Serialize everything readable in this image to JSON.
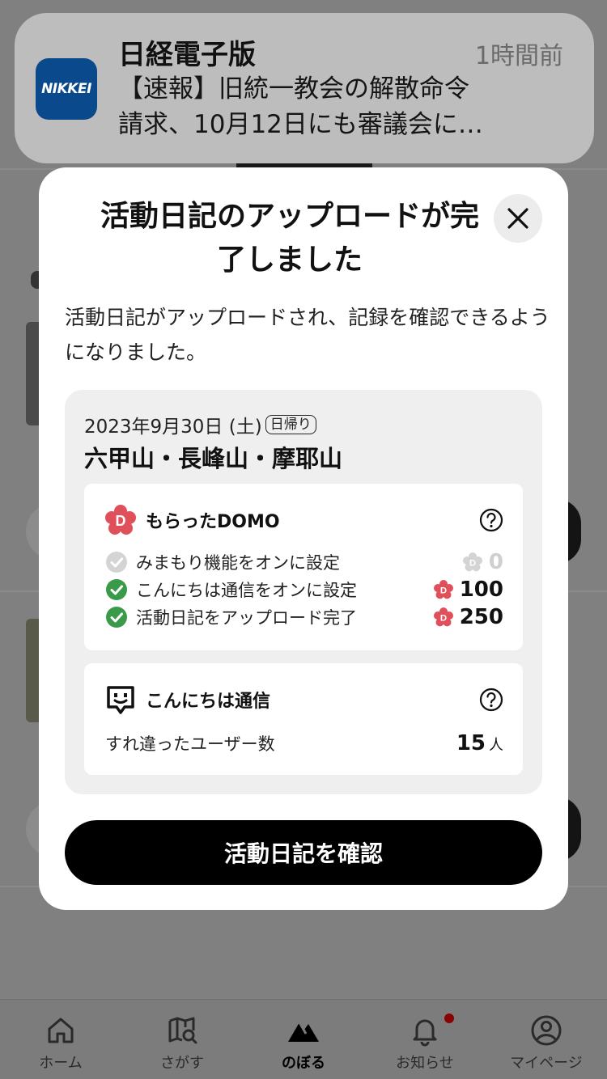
{
  "notification": {
    "app_name": "日経電子版",
    "time": "1時間前",
    "logo_text": "NIKKEI",
    "line1": "【速報】旧統一教会の解散命令",
    "line2": "請求、10月12日にも審議会に…"
  },
  "modal": {
    "title": "活動日記のアップロードが完了しました",
    "description": "活動日記がアップロードされ、記録を確認できるようになりました。",
    "summary": {
      "date": "2023年9月30日 (土)",
      "trip_type": "日帰り",
      "route_name": "六甲山・長峰山・摩耶山"
    },
    "domo": {
      "title": "もらったDOMO",
      "items": [
        {
          "label": "みまもり機能をオンに設定",
          "points": "0",
          "done": false
        },
        {
          "label": "こんにちは通信をオンに設定",
          "points": "100",
          "done": true
        },
        {
          "label": "活動日記をアップロード完了",
          "points": "250",
          "done": true
        }
      ]
    },
    "konnichiwa": {
      "title": "こんにちは通信",
      "label": "すれ違ったユーザー数",
      "count": "15",
      "unit": "人"
    },
    "cta_label": "活動日記を確認"
  },
  "tabbar": {
    "items": [
      {
        "label": "ホーム",
        "icon": "home-icon"
      },
      {
        "label": "さがす",
        "icon": "map-search-icon"
      },
      {
        "label": "のぼる",
        "icon": "mountain-icon",
        "active": true
      },
      {
        "label": "お知らせ",
        "icon": "bell-icon"
      },
      {
        "label": "マイページ",
        "icon": "user-icon"
      }
    ]
  },
  "colors": {
    "accent_check": "#3a9a4a",
    "domo_red": "#e0505a",
    "nikkei_blue": "#0a4a8c",
    "notification_dot": "#8b0000"
  }
}
